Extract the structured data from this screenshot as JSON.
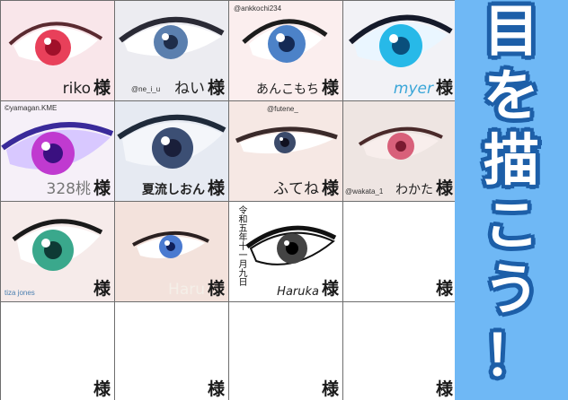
{
  "title_chars": [
    "目",
    "を",
    "描",
    "こ",
    "う",
    "！"
  ],
  "sama": "様",
  "cells": [
    {
      "artist": "riko",
      "handle": ""
    },
    {
      "artist": "ねい",
      "handle": "@ne_i_u"
    },
    {
      "artist": "あんこもち",
      "handle": "@ankkochi234"
    },
    {
      "artist": "myer",
      "handle": ""
    },
    {
      "artist": "328桃",
      "handle": "©yamagan.KME"
    },
    {
      "artist": "夏流しおん",
      "handle": ""
    },
    {
      "artist": "ふてね",
      "handle": "@futene_"
    },
    {
      "artist": "わかた",
      "handle": "@wakata_1"
    },
    {
      "artist": "",
      "handle": "tiza jones"
    },
    {
      "artist": "Haru",
      "handle": ""
    },
    {
      "artist": "Haruka",
      "handle": "",
      "vertical_note": "令和五年十一月九日"
    },
    {
      "artist": "",
      "handle": ""
    },
    {
      "artist": "",
      "handle": ""
    },
    {
      "artist": "",
      "handle": ""
    },
    {
      "artist": "",
      "handle": ""
    },
    {
      "artist": "",
      "handle": ""
    }
  ],
  "colors": {
    "sidebar": "#6fb8f5",
    "title_outline": "#1d5fa8",
    "grid_line": "#6e6e6e"
  }
}
